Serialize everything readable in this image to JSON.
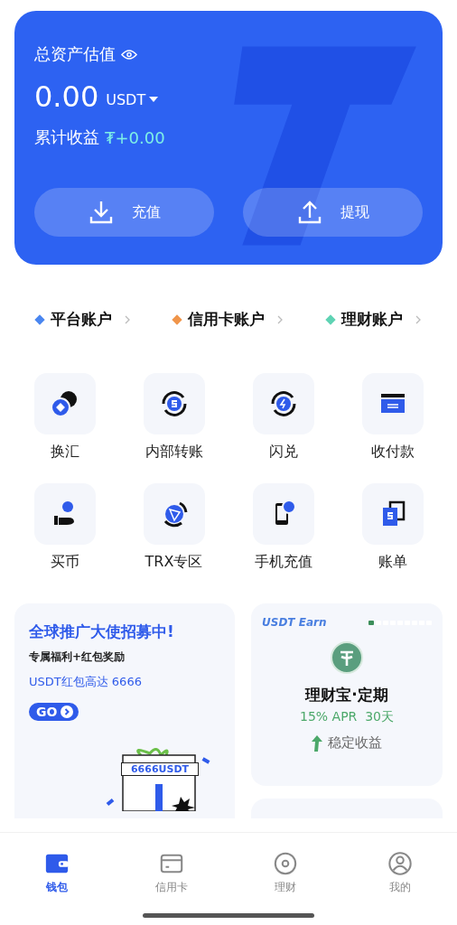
{
  "balance_card": {
    "title": "总资产估值",
    "amount": "0.00",
    "currency": "USDT",
    "earnings_label": "累计收益",
    "earnings_value": "₮+0.00",
    "buttons": [
      "充值",
      "提现"
    ]
  },
  "accounts": [
    {
      "label": "平台账户",
      "color": "#4a86f0"
    },
    {
      "label": "信用卡账户",
      "color": "#f0954a"
    },
    {
      "label": "理财账户",
      "color": "#5fd3b4"
    }
  ],
  "shortcuts": [
    "换汇",
    "内部转账",
    "闪兑",
    "收付款",
    "买币",
    "TRX专区",
    "手机充值",
    "账单"
  ],
  "promo": {
    "title": "全球推广大使招募中!",
    "subtitle": "专属福利+红包奖励",
    "highlight": "USDT红包高达 6666",
    "button": "GO",
    "gift_label": "6666USDT"
  },
  "earn_card": {
    "brand": "USDT Earn",
    "title": "理财宝·定期",
    "rate": "15% APR  30天",
    "tag": "稳定收益",
    "pager": [
      {
        "selected": true
      },
      {
        "selected": false
      },
      {
        "selected": false
      },
      {
        "selected": false
      },
      {
        "selected": false
      },
      {
        "selected": false
      },
      {
        "selected": false
      },
      {
        "selected": false
      },
      {
        "selected": false
      }
    ]
  },
  "tab_bar": [
    {
      "label": "钱包",
      "selected": true
    },
    {
      "label": "信用卡",
      "selected": false
    },
    {
      "label": "理财",
      "selected": false
    },
    {
      "label": "我的",
      "selected": false
    }
  ]
}
